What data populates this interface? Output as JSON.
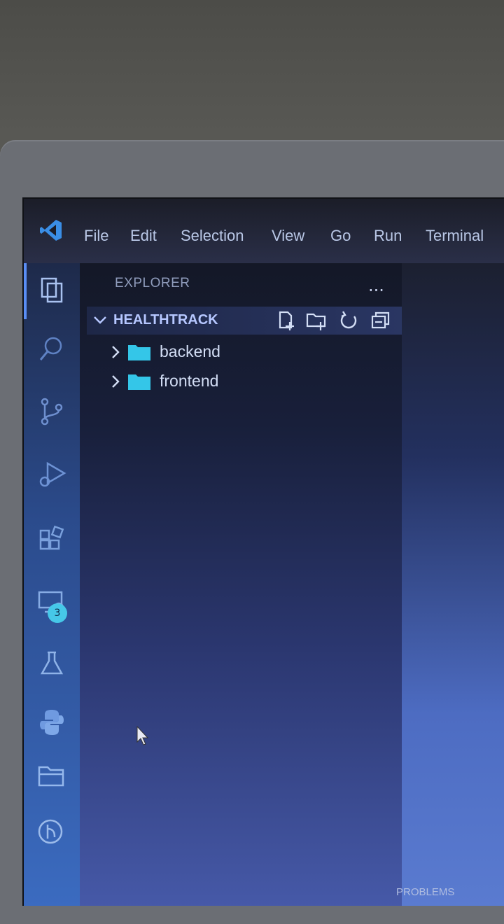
{
  "menubar": {
    "items": [
      "File",
      "Edit",
      "Selection",
      "View",
      "Go",
      "Run",
      "Terminal"
    ]
  },
  "activity_bar": {
    "icons": [
      "explorer-icon",
      "search-icon",
      "source-control-icon",
      "run-debug-icon",
      "extensions-icon",
      "remote-explorer-icon",
      "testing-icon",
      "python-icon",
      "folder-icon",
      "git-graph-icon"
    ],
    "extensions_badge": "3"
  },
  "sidebar": {
    "title": "EXPLORER",
    "more_label": "...",
    "section_title": "HEALTHTRACK",
    "tree": [
      {
        "label": "backend"
      },
      {
        "label": "frontend"
      }
    ]
  },
  "panel": {
    "label": "PROBLEMS"
  },
  "colors": {
    "folder": "#34c6e8",
    "accent": "#5a8ef5",
    "badge": "#46c8e8"
  }
}
